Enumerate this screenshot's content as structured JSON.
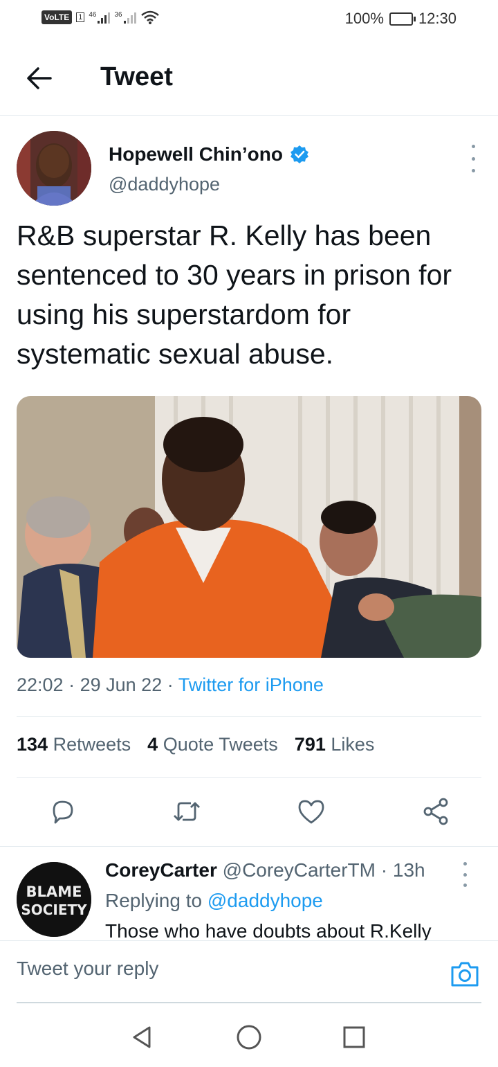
{
  "status_bar": {
    "volte": "VoLTE",
    "sim": "1",
    "sig1": "46",
    "sig2": "36",
    "battery": "100%",
    "time": "12:30"
  },
  "header": {
    "title": "Tweet"
  },
  "tweet": {
    "author_name": "Hopewell Chin’ono",
    "author_handle": "@daddyhope",
    "text": "R&B superstar R. Kelly has been sentenced to 30 years in prison for using his superstardom for systematic sexual abuse.",
    "time": "22:02",
    "date": "29 Jun 22",
    "source": "Twitter for iPhone",
    "sep": "·",
    "retweets_count": "134",
    "retweets_label": "Retweets",
    "quotes_count": "4",
    "quotes_label": "Quote Tweets",
    "likes_count": "791",
    "likes_label": "Likes"
  },
  "reply": {
    "name": "CoreyCarter",
    "handle": "@CoreyCarterTM",
    "age": "13h",
    "sep": "·",
    "replying_prefix": "Replying to",
    "replying_handle": "@daddyhope",
    "text": "Those who have doubts about R.Kelly",
    "avatar_text_1": "BLAME",
    "avatar_text_2": "SOCIETY"
  },
  "composer": {
    "placeholder": "Tweet your reply"
  },
  "icons": {
    "back": "arrow-left-icon",
    "verified": "verified-badge-icon",
    "more": "more-vertical-icon",
    "reply": "reply-icon",
    "retweet": "retweet-icon",
    "like": "heart-icon",
    "share": "share-icon",
    "camera": "camera-icon",
    "nav_back": "triangle-back-icon",
    "nav_home": "circle-home-icon",
    "nav_recents": "square-recents-icon"
  },
  "colors": {
    "accent": "#1d9bf0",
    "secondary_text": "#536471",
    "primary_text": "#0f1419"
  }
}
